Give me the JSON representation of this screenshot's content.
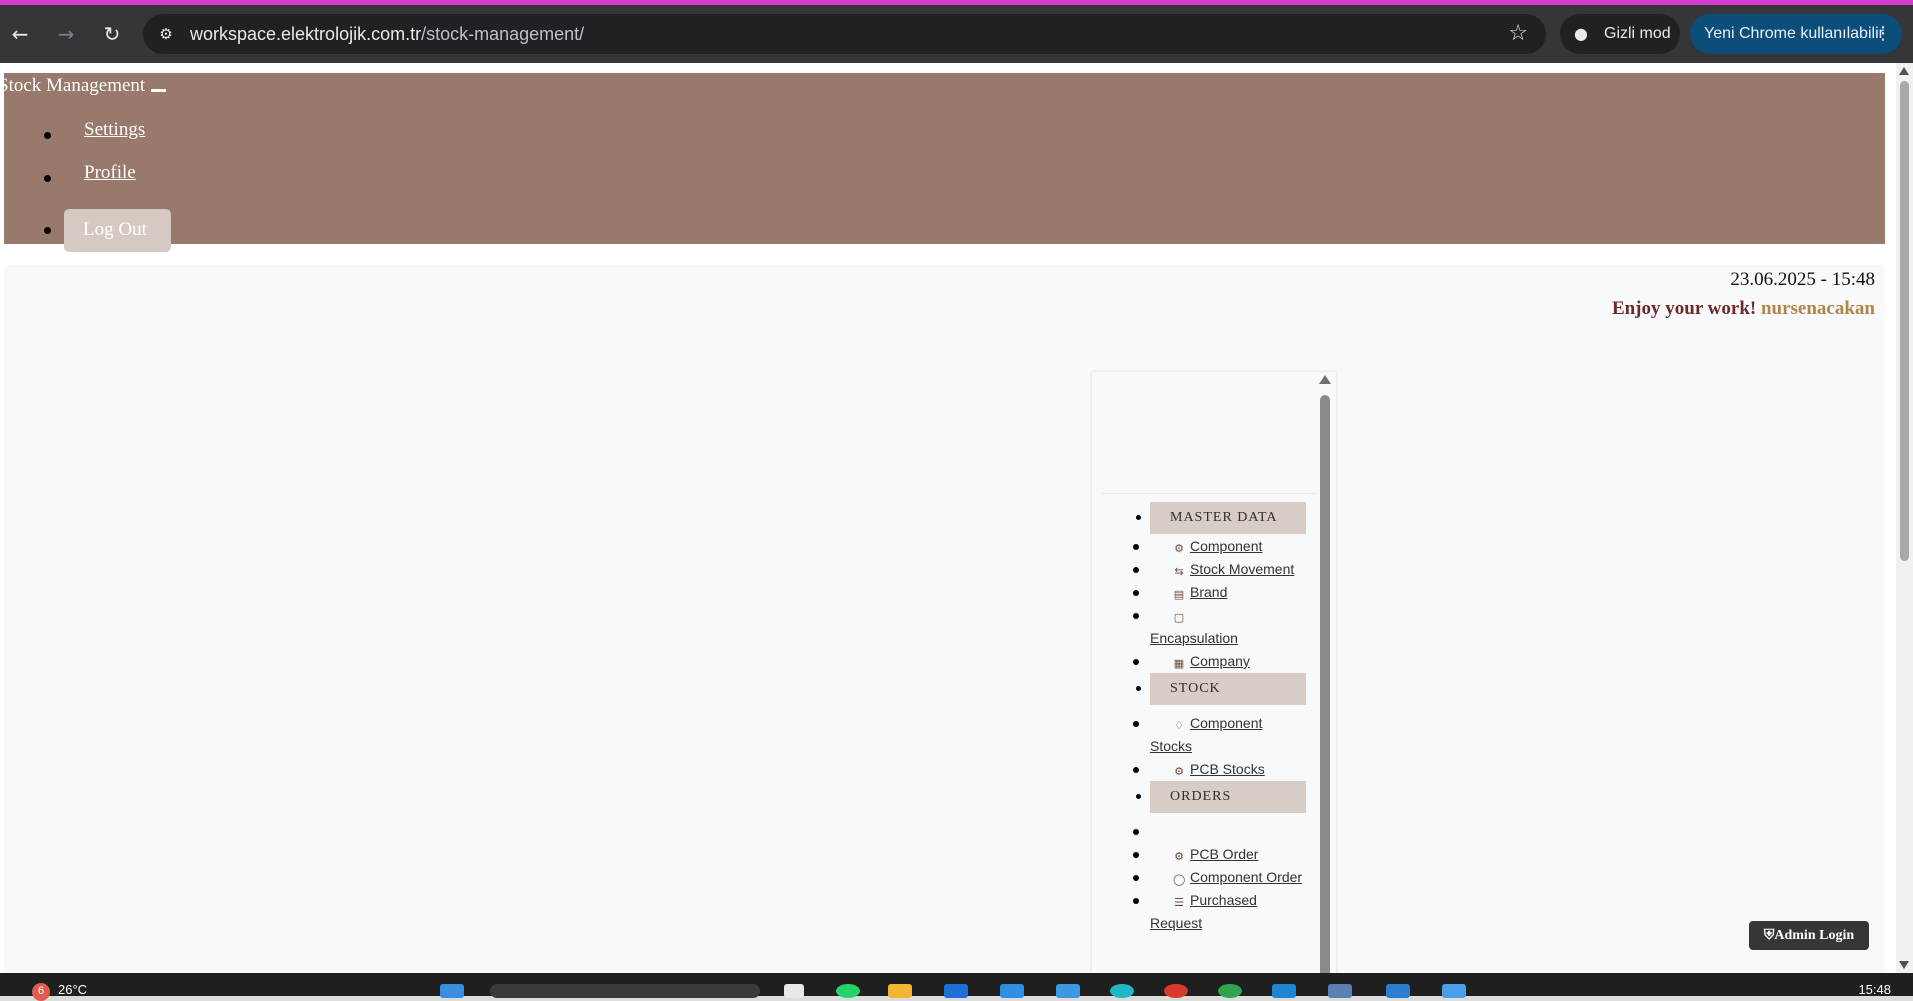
{
  "browser": {
    "url_domain": "workspace.elektrolojik.com.tr",
    "url_path": "/stock-management/",
    "incognito_label": "Gizli mod",
    "update_label": "Yeni Chrome kullanılabilir",
    "accent_color": "#d63dcf"
  },
  "header": {
    "brand": "Stock Management",
    "menu": [
      {
        "label": "Settings"
      },
      {
        "label": "Profile"
      }
    ],
    "logout_label": "Log Out",
    "background": "#98796b"
  },
  "main": {
    "datetime": "23.06.2025 - 15:48",
    "welcome_prefix": "Enjoy your work!",
    "username": "nursenacakan"
  },
  "sidebar": {
    "sections": [
      {
        "title": "MASTER DATA",
        "items": [
          {
            "label": "Component",
            "icon": "gear-icon"
          },
          {
            "label": "Stock Movement",
            "icon": "swap-arrows-icon"
          },
          {
            "label": "Brand",
            "icon": "archive-box-icon"
          },
          {
            "label": "Encapsulation",
            "icon": "package-icon"
          },
          {
            "label": "Company",
            "icon": "building-icon"
          }
        ]
      },
      {
        "title": "STOCK",
        "items": [
          {
            "label": "Component Stocks",
            "icon": "boxes-icon"
          },
          {
            "label": "PCB Stocks",
            "icon": "chip-icon"
          }
        ]
      },
      {
        "title": "ORDERS",
        "items": [
          {
            "label": "",
            "icon": ""
          },
          {
            "label": "PCB Order",
            "icon": "chip-icon"
          },
          {
            "label": "Component Order",
            "icon": "cog-icon"
          },
          {
            "label": "Purchased Request",
            "icon": "list-icon"
          }
        ]
      }
    ]
  },
  "admin_login_label": "Admin Login",
  "taskbar": {
    "weather_badge": "6",
    "temperature": "26°C",
    "clock": "15:48"
  }
}
